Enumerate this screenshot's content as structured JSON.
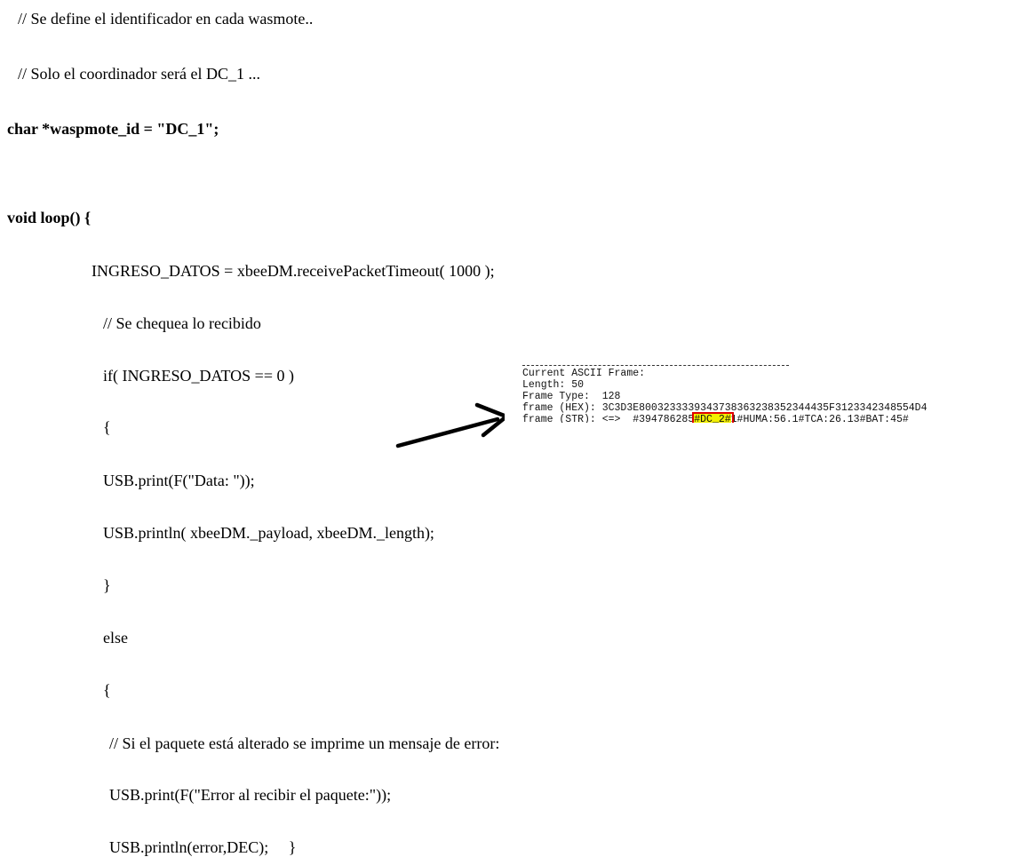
{
  "code": {
    "comment_1": "// Se define el identificador en cada wasmote..",
    "comment_2": "// Solo el coordinador será el DC_1 ...",
    "decl": "char *waspmote_id = \"DC_1\";",
    "loop_sig": "void loop() {",
    "assign": "INGRESO_DATOS = xbeeDM.receivePacketTimeout( 1000 );",
    "comment_check": "// Se chequea lo recibido",
    "if_stmt": "if( INGRESO_DATOS == 0 )",
    "brace_open_1": "{",
    "print_data": "USB.print(F(\"Data: \"));",
    "println_payload": "USB.println( xbeeDM._payload, xbeeDM._length);",
    "brace_close_1": "}",
    "else_kw": "else",
    "brace_open_2": "{",
    "comment_error": "// Si el paquete está alterado se imprime un mensaje de error:",
    "print_error": "USB.print(F(\"Error al recibir el paquete:\"));",
    "println_error": "USB.println(error,DEC);     }"
  },
  "frame_output": {
    "title": "Current ASCII Frame:",
    "length": "Length: 50",
    "frame_type": "Frame Type:  128",
    "hex": "frame (HEX): 3C3D3E8003233339343738363238352344435F3123342348554D4",
    "str_prefix": "frame (STR): <=>  #394786285",
    "str_highlight": "#DC_2#",
    "str_suffix": "1#HUMA:56.1#TCA:26.13#BAT:45#"
  },
  "colors": {
    "highlight": "#f2ef00",
    "box_outline": "#e00000",
    "arrow": "#000000"
  }
}
